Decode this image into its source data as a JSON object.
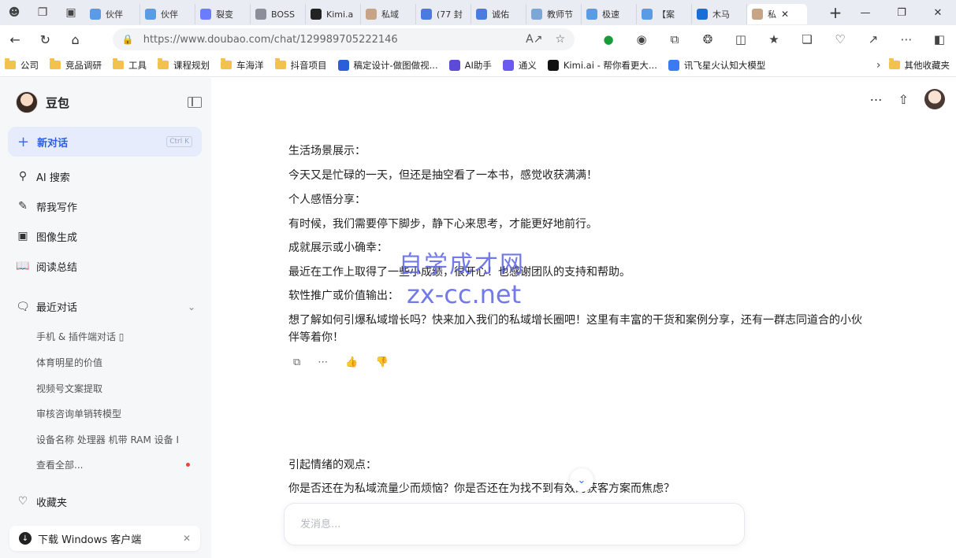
{
  "browser": {
    "tabs": [
      {
        "label": "伙伴",
        "color": "#5a9be6"
      },
      {
        "label": "伙伴",
        "color": "#5a9be6"
      },
      {
        "label": "裂变",
        "color": "#6b7cff"
      },
      {
        "label": "BOSS",
        "color": "#8a8f99"
      },
      {
        "label": "Kimi.a",
        "color": "#222222"
      },
      {
        "label": "私域",
        "color": "#c8a487"
      },
      {
        "label": "(77 封",
        "color": "#4a7be0"
      },
      {
        "label": "诚佑",
        "color": "#4a7be0"
      },
      {
        "label": "教师节",
        "color": "#7aa7d8"
      },
      {
        "label": "极速",
        "color": "#5a9be6"
      },
      {
        "label": "【案",
        "color": "#5a9be6"
      },
      {
        "label": "木马",
        "color": "#1a6fd6"
      }
    ],
    "active_tab": {
      "label": "私",
      "color": "#c8a487"
    },
    "url": "https://www.doubao.com/chat/1299897052221​46",
    "bookmarks": [
      {
        "label": "公司",
        "type": "folder"
      },
      {
        "label": "竞品调研",
        "type": "folder"
      },
      {
        "label": "工具",
        "type": "folder"
      },
      {
        "label": "课程规划",
        "type": "folder"
      },
      {
        "label": "车海洋",
        "type": "folder"
      },
      {
        "label": "抖音项目",
        "type": "folder"
      },
      {
        "label": "稿定设计-做图做视...",
        "type": "link",
        "color": "#2b5fd9"
      },
      {
        "label": "AI助手",
        "type": "link",
        "color": "#5b4bd6"
      },
      {
        "label": "通义",
        "type": "link",
        "color": "#6a5af0"
      },
      {
        "label": "Kimi.ai - 帮你看更大...",
        "type": "link",
        "color": "#111111"
      },
      {
        "label": "讯飞星火认知大模型",
        "type": "link",
        "color": "#3a7bf2"
      }
    ],
    "other_bookmarks": "其他收藏夹"
  },
  "sidebar": {
    "brand": "豆包",
    "new_chat": "新对话",
    "new_chat_kbd": "Ctrl K",
    "nav": [
      {
        "label": "AI 搜索",
        "icon": "search-icon"
      },
      {
        "label": "帮我写作",
        "icon": "pen-icon"
      },
      {
        "label": "图像生成",
        "icon": "image-icon"
      },
      {
        "label": "阅读总结",
        "icon": "book-icon"
      }
    ],
    "recent_title": "最近对话",
    "recent": [
      "手机 & 插件端对话 ▯",
      "体育明星的价值",
      "视频号文案提取",
      "审核咨询单销转模型",
      "设备名称 处理器 机带 RAM 设备 I",
      "查看全部..."
    ],
    "favorites": "收藏夹",
    "download": "下载 Windows 客户端"
  },
  "chat": {
    "lines": [
      "生活场景展示：",
      "今天又是忙碌的一天，但还是抽空看了一本书，感觉收获满满！",
      "个人感悟分享：",
      "有时候，我们需要停下脚步，静下心来思考，才能更好地前行。",
      "成就展示或小确幸：",
      "最近在工作上取得了一些小成绩，很开心！也感谢团队的支持和帮助。",
      "软性推广或价值输出：",
      "想了解如何引爆私域增长吗？快来加入我们的私域增长圈吧！这里有丰富的干货和案例分享，还有一群志同道合的小伙伴等着你！"
    ],
    "lines2": [
      "引起情绪的观点：",
      "你是否还在为私域流量少而烦恼？你是否还在为找不到有效的获客方案而焦虑？"
    ],
    "watermark_cn": "自学成才网",
    "watermark_en": "zx-cc.net",
    "composer_placeholder": "发消息..."
  }
}
